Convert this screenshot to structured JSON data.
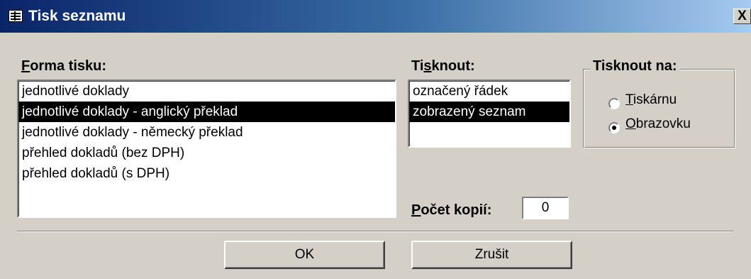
{
  "window": {
    "title": "Tisk seznamu",
    "close_label": "X"
  },
  "forma_tisku": {
    "label_accel": "F",
    "label_rest": "orma tisku:",
    "items": [
      {
        "label": "jednotlivé doklady",
        "selected": false
      },
      {
        "label": "jednotlivé doklady - anglický překlad",
        "selected": true
      },
      {
        "label": "jednotlivé doklady - německý překlad",
        "selected": false
      },
      {
        "label": "přehled dokladů (bez DPH)",
        "selected": false
      },
      {
        "label": "přehled dokladů (s DPH)",
        "selected": false
      }
    ]
  },
  "tisknout": {
    "label_pre": "Ti",
    "label_accel": "s",
    "label_rest": "knout:",
    "items": [
      {
        "label": "označený řádek",
        "selected": false
      },
      {
        "label": "zobrazený seznam",
        "selected": true
      }
    ]
  },
  "tisknout_na": {
    "label": "Tisknout na:",
    "options": [
      {
        "accel": "T",
        "rest": "iskárnu",
        "checked": false
      },
      {
        "accel": "O",
        "rest": "brazovku",
        "checked": true
      }
    ]
  },
  "kopie": {
    "label_accel": "P",
    "label_rest": "očet kopií:",
    "value": "0"
  },
  "buttons": {
    "ok": "OK",
    "cancel": "Zrušit"
  }
}
